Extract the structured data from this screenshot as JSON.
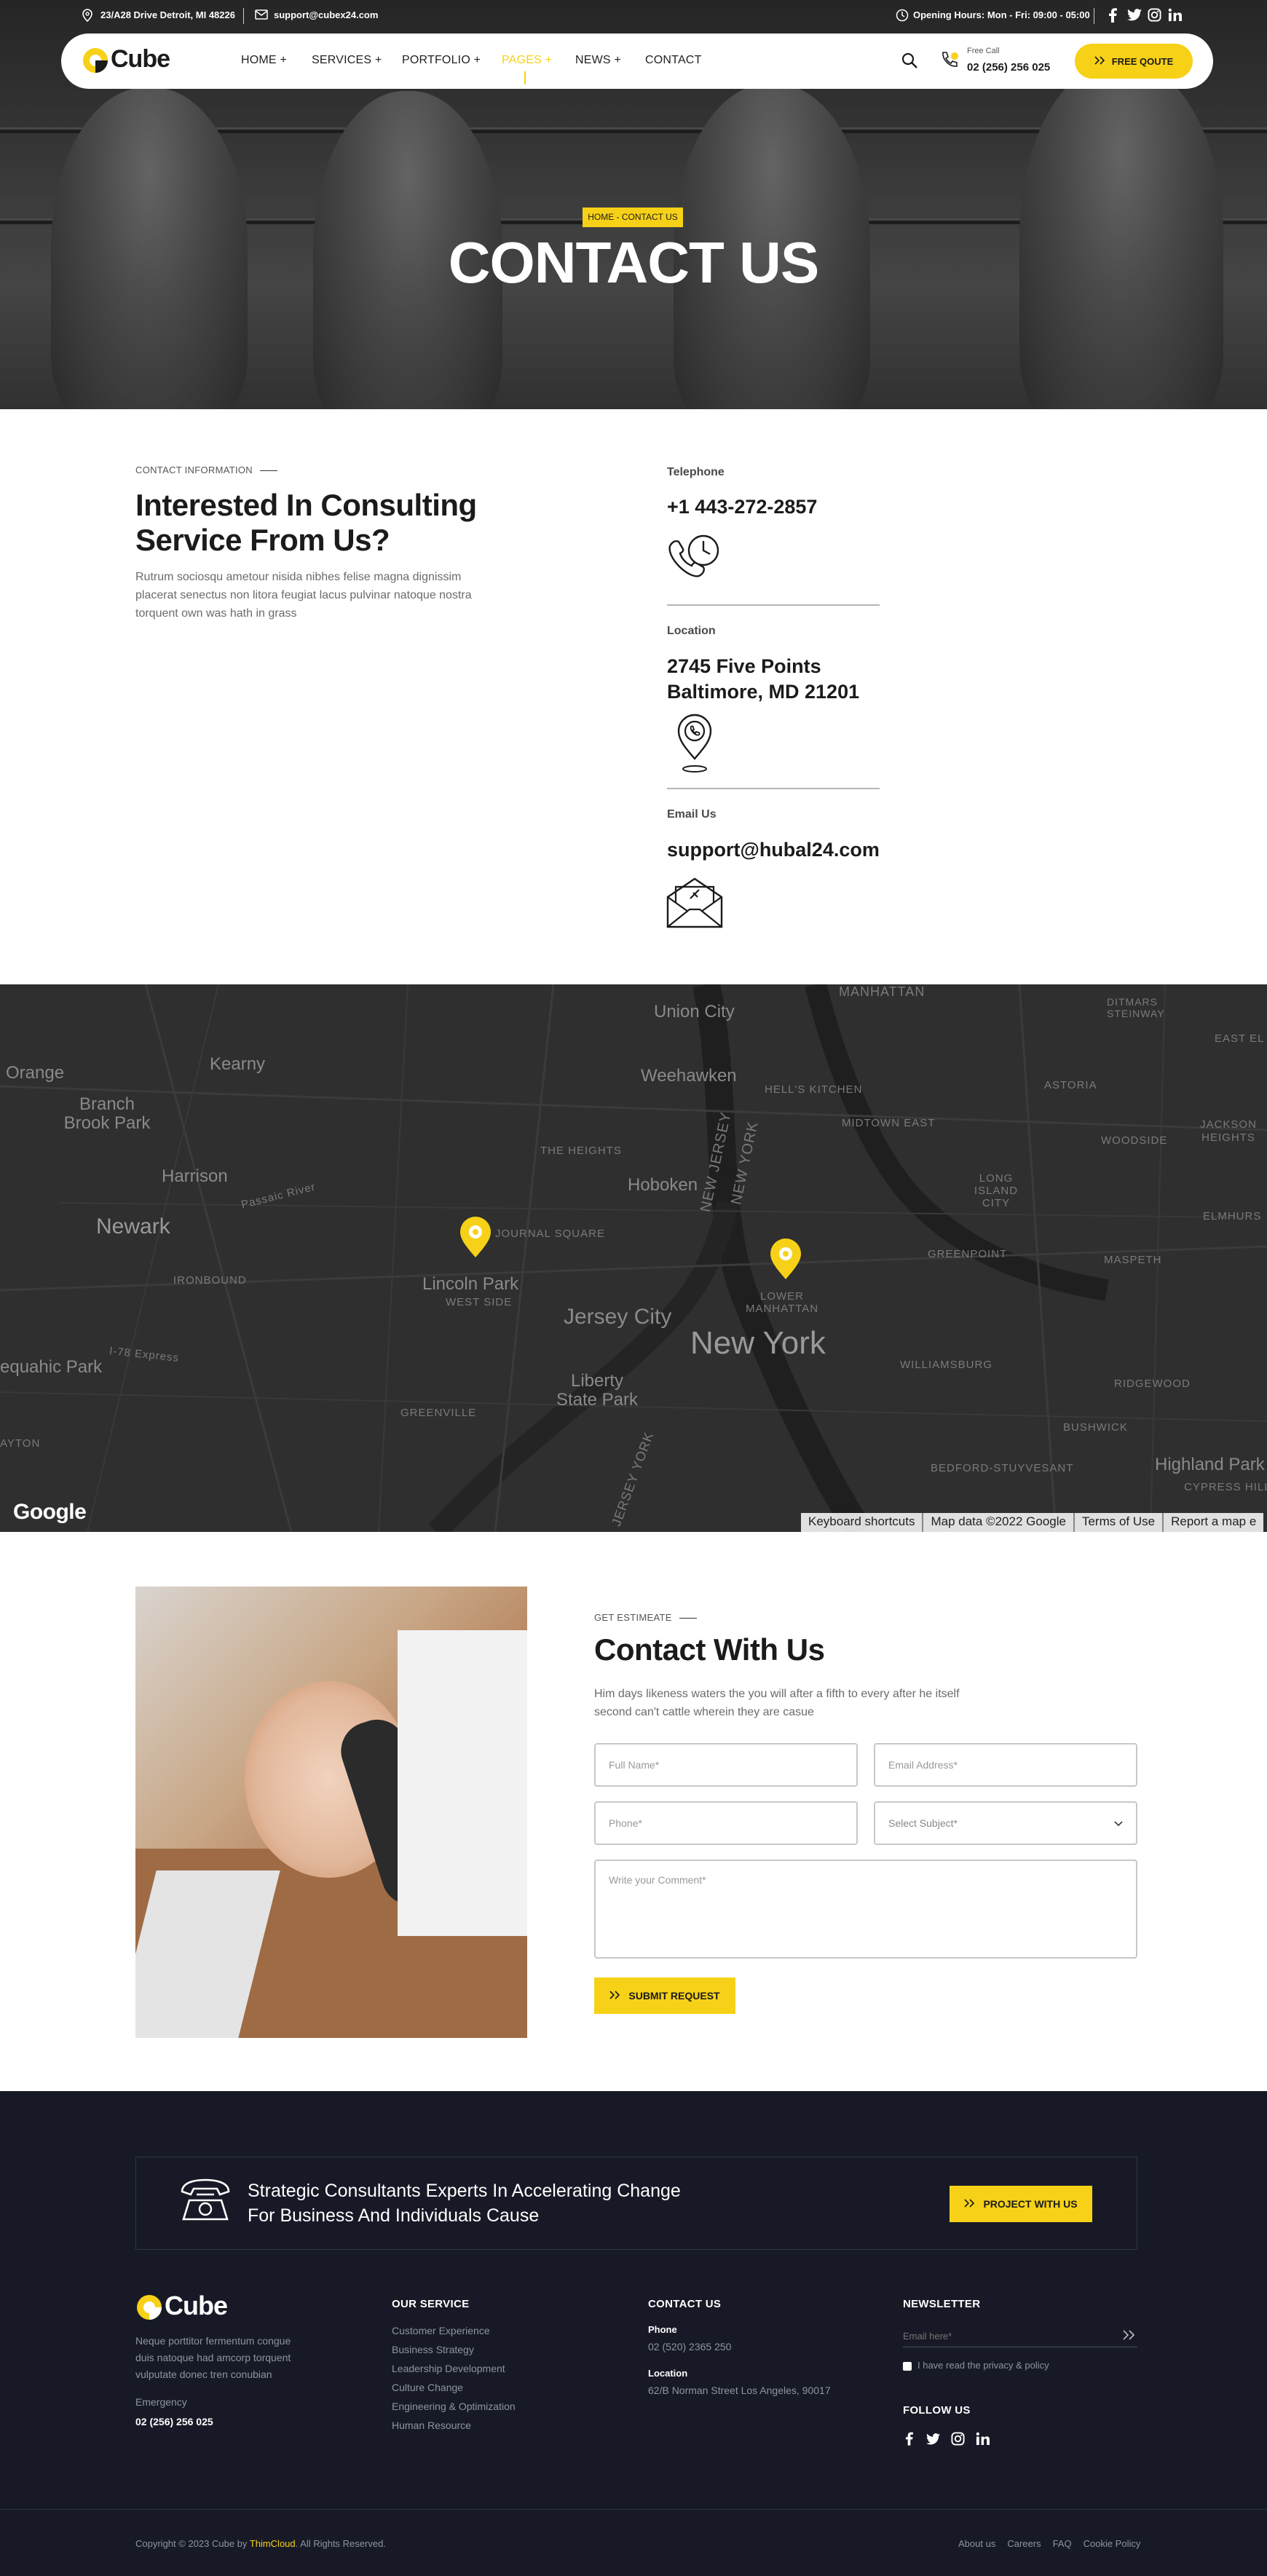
{
  "colors": {
    "accent": "#f7d117",
    "dark": "#171a26",
    "text": "#1b1b1b"
  },
  "topbar": {
    "address": "23/A28 Drive Detroit, MI 48226",
    "email": "support@cubex24.com",
    "hours": "Opening Hours: Mon - Fri: 09:00 - 05:00"
  },
  "brand": {
    "name": "Cube"
  },
  "nav": {
    "items": [
      "HOME +",
      "SERVICES +",
      "PORTFOLIO +",
      "PAGES +",
      "NEWS +",
      "CONTACT"
    ],
    "active": "PAGES +",
    "call_label": "Free Call",
    "call_number": "02 (256) 256 025",
    "quote_button": "FREE QOUTE"
  },
  "hero": {
    "breadcrumb": "HOME - CONTACT US",
    "title": "CONTACT US"
  },
  "info": {
    "eyebrow": "CONTACT INFORMATION",
    "title_line1": "Interested In Consulting",
    "title_line2": "Service From Us?",
    "text_line1": "Rutrum sociosqu ametour nisida nibhes felise magna dignissim",
    "text_line2": "placerat senectus non litora feugiat lacus pulvinar natoque nostra",
    "text_line3": "torquent own was hath in grass",
    "telephone_label": "Telephone",
    "telephone": "+1 443-272-2857",
    "location_label": "Location",
    "location_line1": "2745 Five Points",
    "location_line2": "Baltimore, MD 21201",
    "email_label": "Email Us",
    "email": "support@hubal24.com"
  },
  "map": {
    "labels": [
      "MANHATTAN",
      "Union City",
      "DITMARS STEINWAY",
      "EAST EL",
      "Orange",
      "Kearny",
      "Weehawken",
      "HELL'S KITCHEN",
      "ASTORIA",
      "Branch Brook Park",
      "MIDTOWN EAST",
      "WOODSIDE",
      "JACKSON HEIGHTS",
      "THE HEIGHTS",
      "Harrison",
      "Hoboken",
      "NEW JERSEY",
      "NEW YORK",
      "LONG ISLAND CITY",
      "Passaic River",
      "Newark",
      "ELMHURS",
      "JOURNAL SQUARE",
      "IRONBOUND",
      "Lincoln Park",
      "WEST SIDE",
      "LOWER MANHATTAN",
      "GREENPOINT",
      "MASPETH",
      "Jersey City",
      "I-78 Express",
      "equahic Park",
      "New York",
      "WILLIAMSBURG",
      "Liberty State Park",
      "RIDGEWOOD",
      "GREENVILLE",
      "BUSHWICK",
      "AYTON",
      "BEDFORD-STUYVESANT",
      "Highland Park",
      "CYPRESS HILL",
      "JERSEY YORK"
    ],
    "logo": "Google",
    "attribution": [
      "Keyboard shortcuts",
      "Map data ©2022 Google",
      "Terms of Use",
      "Report a map e"
    ]
  },
  "estimate": {
    "eyebrow": "GET ESTIMEATE",
    "title": "Contact With Us",
    "text_line1": "Him days likeness waters the you will after a fifth to every after he itself",
    "text_line2": "second can't cattle wherein they are casue",
    "name_placeholder": "Full Name*",
    "email_placeholder": "Email Address*",
    "phone_placeholder": "Phone*",
    "subject_selected": "Select Subject*",
    "comment_placeholder": "Write your Comment*",
    "submit": "SUBMIT REQUEST"
  },
  "cta": {
    "line1": "Strategic Consultants Experts In Accelerating Change",
    "line2": "For Business And Individuals Cause",
    "button": "PROJECT WITH US"
  },
  "footer": {
    "about_line1": "Neque porttitor fermentum congue",
    "about_line2": "duis natoque had amcorp torquent",
    "about_line3": "vulputate donec tren conubian",
    "emergency_label": "Emergency",
    "emergency_number": "02 (256) 256 025",
    "service_title": "OUR SERVICE",
    "services": [
      "Customer Experience",
      "Business Strategy",
      "Leadership Development",
      "Culture Change",
      "Engineering & Optimization",
      "Human Resource"
    ],
    "contact_title": "CONTACT US",
    "phone_label": "Phone",
    "phone": "02 (520) 2365 250",
    "location_label": "Location",
    "location": "62/B Norman Street Los Angeles, 90017",
    "newsletter_title": "NEWSLETTER",
    "newsletter_placeholder": "Email here*",
    "privacy": "I have read the privacy & policy",
    "follow_title": "FOLLOW US",
    "copyright_prefix": "Copyright © 2023 Cube by ",
    "copyright_brand": "ThimCloud",
    "copyright_suffix": ". All Rights Reserved.",
    "links": [
      "About us",
      "Careers",
      "FAQ",
      "Cookie Policy"
    ]
  }
}
